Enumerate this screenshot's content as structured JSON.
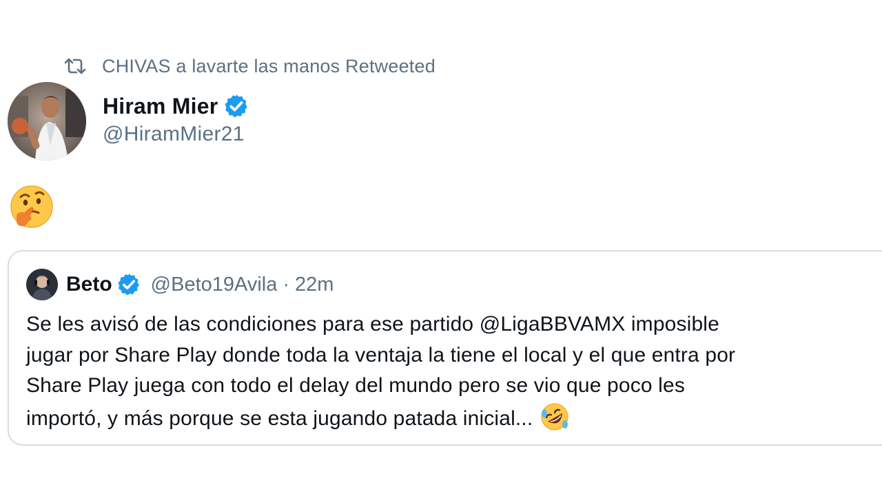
{
  "retweet_context": {
    "icon": "retweet-icon",
    "text": "CHIVAS a lavarte las manos Retweeted"
  },
  "tweet": {
    "author": {
      "name": "Hiram Mier",
      "handle": "@HiramMier21",
      "verified_icon": "verified-badge-icon",
      "avatar_icon": "profile-photo"
    },
    "body_emoji": "thinking-face-emoji"
  },
  "quoted_tweet": {
    "author": {
      "name": "Beto",
      "handle": "@Beto19Avila",
      "verified_icon": "verified-badge-icon",
      "avatar_icon": "profile-photo"
    },
    "separator": "·",
    "time": "22m",
    "lines": [
      "Se les avisó de las condiciones para ese partido @LigaBBVAMX imposible",
      "jugar por Share Play donde toda la ventaja la tiene el local y el que entra por",
      "Share Play juega con todo el delay del mundo pero se vio que poco les",
      "importó, y más porque se esta jugando patada inicial..."
    ],
    "trailing_emoji": "rolling-on-floor-laughing-emoji"
  },
  "colors": {
    "text_primary": "#0f1419",
    "text_secondary": "#5b7083",
    "verified_blue": "#1d9bf0",
    "card_border": "#d6dde3"
  }
}
